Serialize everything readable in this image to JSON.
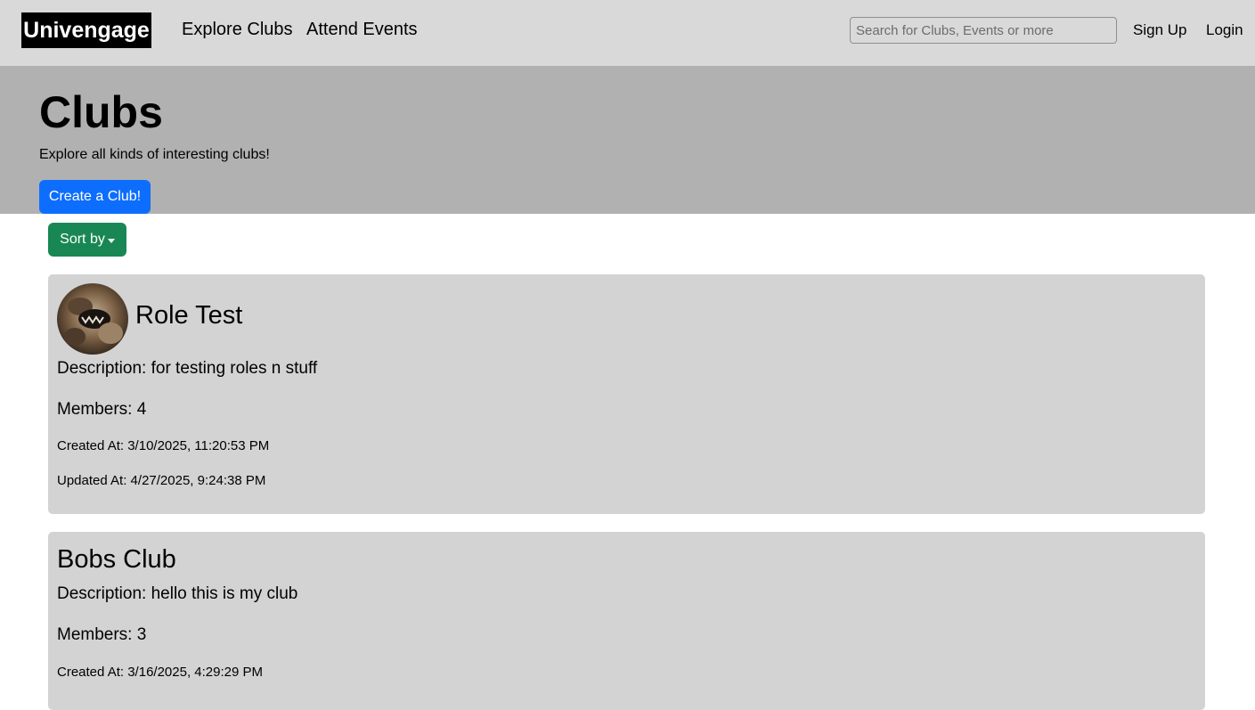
{
  "nav": {
    "brand": "Univengage",
    "links": [
      "Explore Clubs",
      "Attend Events"
    ],
    "search_placeholder": "Search for Clubs, Events or more",
    "sign_up": "Sign Up",
    "login": "Login"
  },
  "hero": {
    "title": "Clubs",
    "subtitle": "Explore all kinds of interesting clubs!",
    "create_button": "Create a Club!"
  },
  "sort_button": "Sort by",
  "clubs": [
    {
      "name": "Role Test",
      "description": "Description: for testing roles n stuff",
      "members": "Members: 4",
      "created": "Created At: 3/10/2025, 11:20:53 PM",
      "updated": "Updated At: 4/27/2025, 9:24:38 PM"
    },
    {
      "name": "Bobs Club",
      "description": "Description: hello this is my club",
      "members": "Members: 3",
      "created": "Created At: 3/16/2025, 4:29:29 PM"
    }
  ]
}
